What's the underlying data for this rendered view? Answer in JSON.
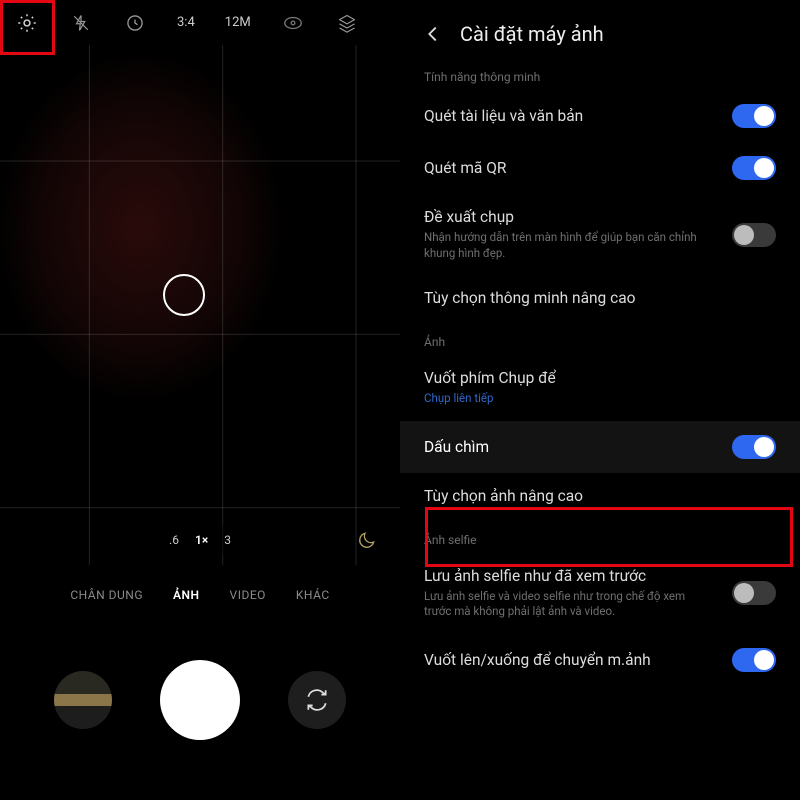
{
  "camera": {
    "top": {
      "aspect": "3:4",
      "mp": "12M"
    },
    "zoom": {
      "levels": [
        ".6",
        "1×",
        "3"
      ],
      "active": 1
    },
    "modes": {
      "items": [
        "CHÂN DUNG",
        "ẢNH",
        "VIDEO",
        "KHÁC"
      ],
      "active": 1
    }
  },
  "settings": {
    "title": "Cài đặt máy ảnh",
    "sections": {
      "smart": {
        "label": "Tính năng thông minh",
        "scan_docs": {
          "title": "Quét tài liệu và văn bản",
          "on": true
        },
        "scan_qr": {
          "title": "Quét mã QR",
          "on": true
        },
        "suggest": {
          "title": "Đề xuất chụp",
          "sub": "Nhận hướng dẫn trên màn hình để giúp bạn căn chỉnh khung hình đẹp.",
          "on": false
        },
        "advanced": {
          "title": "Tùy chọn thông minh nâng cao"
        }
      },
      "photo": {
        "label": "Ảnh",
        "swipe_shutter": {
          "title": "Vuốt phím Chụp để",
          "sub": "Chụp liên tiếp"
        },
        "watermark": {
          "title": "Dấu chìm",
          "on": true
        },
        "adv_photo": {
          "title": "Tùy chọn ảnh nâng cao"
        }
      },
      "selfie": {
        "label": "Ảnh selfie",
        "save_as_preview": {
          "title": "Lưu ảnh selfie như đã xem trước",
          "sub": "Lưu ảnh selfie và video selfie như trong chế độ xem trước mà không phải lật ảnh và video.",
          "on": false
        },
        "swipe_switch": {
          "title": "Vuốt lên/xuống để chuyển m.ảnh",
          "on": true
        }
      }
    }
  }
}
